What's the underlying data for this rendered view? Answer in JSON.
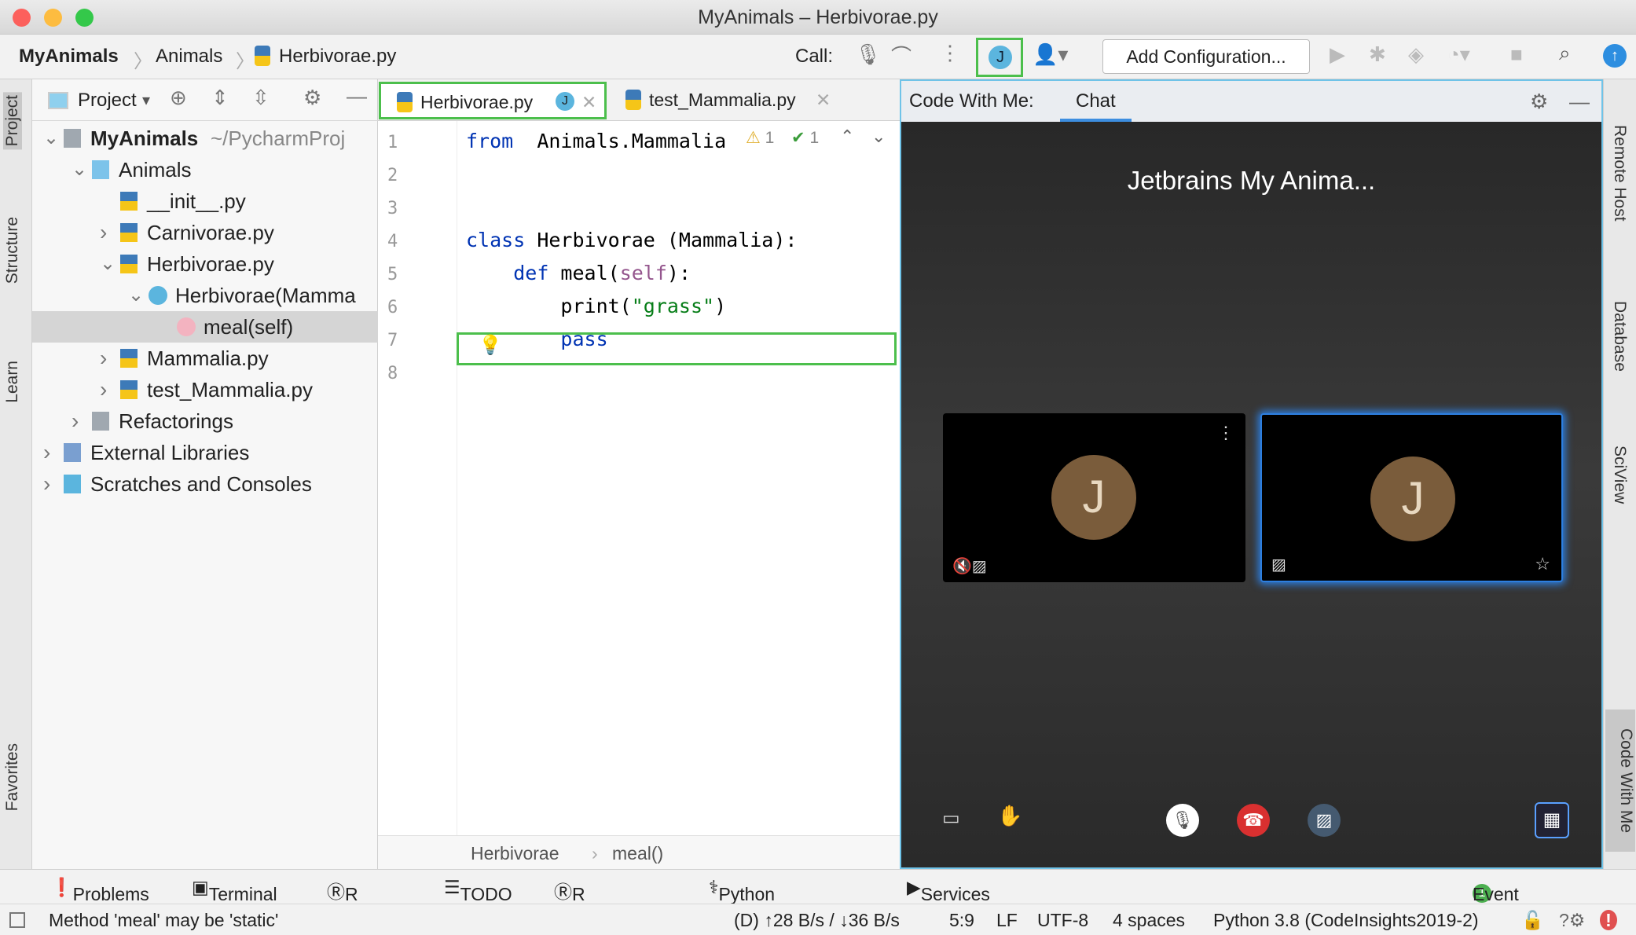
{
  "window": {
    "title": "MyAnimals – Herbivorae.py"
  },
  "toolbar": {
    "breadcrumbs": [
      "MyAnimals",
      "Animals",
      "Herbivorae.py"
    ],
    "call_label": "Call:",
    "user_initial": "J",
    "add_config": "Add Configuration..."
  },
  "left_stripe": [
    "Project",
    "Structure",
    "Learn",
    "Favorites"
  ],
  "right_stripe": [
    "Remote Host",
    "Database",
    "SciView",
    "Code With Me"
  ],
  "project": {
    "title": "Project",
    "tree": [
      {
        "label": "MyAnimals",
        "suffix": "~/PycharmProj",
        "depth": 0,
        "exp": "open",
        "icon": "folder"
      },
      {
        "label": "Animals",
        "depth": 1,
        "exp": "open",
        "icon": "folder-blue"
      },
      {
        "label": "__init__.py",
        "depth": 2,
        "exp": "",
        "icon": "python"
      },
      {
        "label": "Carnivorae.py",
        "depth": 2,
        "exp": "closed",
        "icon": "python"
      },
      {
        "label": "Herbivorae.py",
        "depth": 2,
        "exp": "open",
        "icon": "python"
      },
      {
        "label": "Herbivorae(Mamma",
        "depth": 3,
        "exp": "open",
        "icon": "class"
      },
      {
        "label": "meal(self)",
        "depth": 4,
        "exp": "",
        "icon": "method"
      },
      {
        "label": "Mammalia.py",
        "depth": 2,
        "exp": "closed",
        "icon": "python"
      },
      {
        "label": "test_Mammalia.py",
        "depth": 2,
        "exp": "closed",
        "icon": "python"
      },
      {
        "label": "Refactorings",
        "depth": 1,
        "exp": "closed",
        "icon": "folder"
      },
      {
        "label": "External Libraries",
        "depth": 0,
        "exp": "closed",
        "icon": "library"
      },
      {
        "label": "Scratches and Consoles",
        "depth": 0,
        "exp": "closed",
        "icon": "scratch"
      }
    ]
  },
  "editor": {
    "tabs": [
      {
        "label": "Herbivorae.py",
        "badge": "J",
        "active": true
      },
      {
        "label": "test_Mammalia.py",
        "active": false
      }
    ],
    "inspections": {
      "warnings": "1",
      "ok": "1"
    },
    "lines": [
      [
        [
          "kw",
          "from"
        ],
        [
          "",
          "  Animals.Mammalia"
        ]
      ],
      [],
      [],
      [
        [
          "kw",
          "class"
        ],
        [
          "",
          " Herbivorae (Mammalia):"
        ]
      ],
      [
        [
          "",
          "    "
        ],
        [
          "kw",
          "def"
        ],
        [
          "",
          " meal("
        ],
        [
          "slf",
          "self"
        ],
        [
          "",
          "):"
        ]
      ],
      [
        [
          "",
          "        print("
        ],
        [
          "str",
          "\"grass\""
        ],
        [
          "",
          ")"
        ]
      ],
      [
        [
          "kw",
          "        pass"
        ]
      ],
      []
    ],
    "breadcrumb": [
      "Herbivorae",
      "meal()"
    ]
  },
  "cwm": {
    "label": "Code With Me:",
    "tab": "Chat",
    "session_title": "Jetbrains My Anima...",
    "participants": [
      "J",
      "J"
    ]
  },
  "tool_windows": [
    "Problems",
    "Terminal",
    "R Jobs",
    "TODO",
    "R Console",
    "Python Console",
    "Services"
  ],
  "event_log": {
    "label": "Event Log",
    "count": "1"
  },
  "status": {
    "message": "Method 'meal' may be 'static'",
    "traffic": "(D) ↑28 B/s / ↓36 B/s",
    "position": "5:9",
    "line_sep": "LF",
    "encoding": "UTF-8",
    "indent": "4 spaces",
    "interpreter": "Python 3.8 (CodeInsights2019-2)"
  }
}
